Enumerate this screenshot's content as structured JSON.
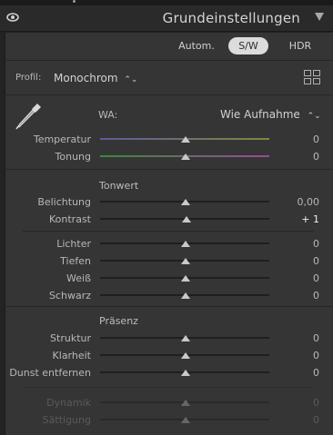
{
  "panel": {
    "title": "Grundeinstellungen",
    "tabs": [
      "Autom.",
      "S/W",
      "HDR"
    ],
    "selected_tab": "S/W"
  },
  "profile": {
    "label": "Profil:",
    "value": "Monochrom"
  },
  "wb": {
    "label": "WA:",
    "value": "Wie Aufnahme"
  },
  "sliders_wb": [
    {
      "label": "Temperatur",
      "value": "0"
    },
    {
      "label": "Tonung",
      "value": "0"
    }
  ],
  "tonwert": {
    "heading": "Tonwert",
    "sliders": [
      {
        "label": "Belichtung",
        "value": "0,00"
      },
      {
        "label": "Kontrast",
        "value": "+ 1"
      }
    ],
    "sliders2": [
      {
        "label": "Lichter",
        "value": "0"
      },
      {
        "label": "Tiefen",
        "value": "0"
      },
      {
        "label": "Weiß",
        "value": "0"
      },
      {
        "label": "Schwarz",
        "value": "0"
      }
    ]
  },
  "praesenz": {
    "heading": "Präsenz",
    "sliders": [
      {
        "label": "Struktur",
        "value": "0"
      },
      {
        "label": "Klarheit",
        "value": "0"
      },
      {
        "label": "Dunst entfernen",
        "value": "0"
      }
    ],
    "disabled_sliders": [
      {
        "label": "Dynamik",
        "value": "0"
      },
      {
        "label": "Sättigung",
        "value": "0"
      }
    ]
  },
  "colors": {
    "accent": "#dcdcdc",
    "panel_bg": "#353535",
    "temp_track": "#6a7a3a",
    "tint_track": "#8a3a8a"
  }
}
